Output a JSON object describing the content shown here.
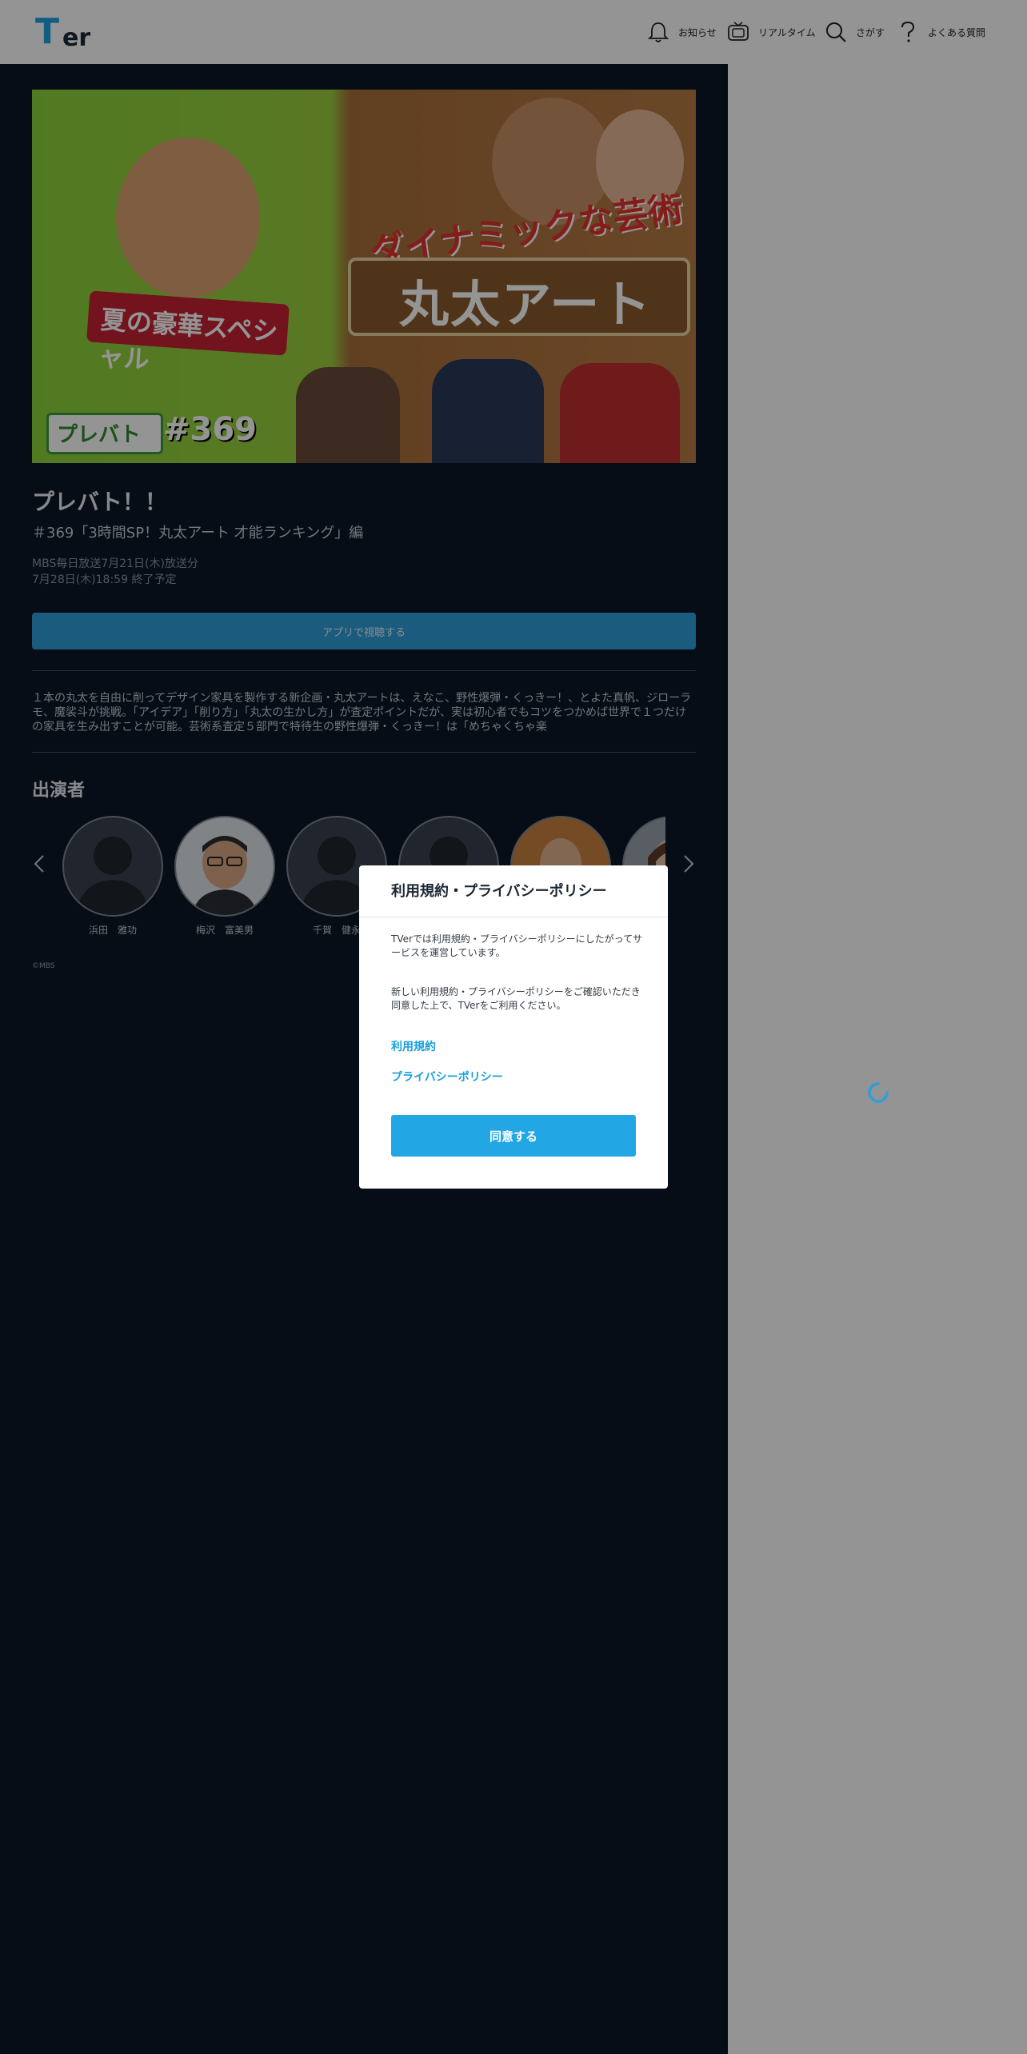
{
  "header": {
    "logo": "TVer",
    "nav": [
      {
        "label": "お知らせ",
        "icon": "bell-icon"
      },
      {
        "label": "リアルタイム",
        "icon": "tv-icon"
      },
      {
        "label": "さがす",
        "icon": "search-icon"
      },
      {
        "label": "よくある質問",
        "icon": "question-icon"
      }
    ]
  },
  "episode": {
    "thumbnail_badge": "プレバト",
    "thumbnail_number": "#369",
    "thumbnail_headline": "ダイナミックな芸術",
    "thumbnail_banner": "丸太アート",
    "thumbnail_ribbon": "夏の豪華スペシャル",
    "title": "プレバト！！",
    "subtitle": "＃369「3時間SP！丸太アート 才能ランキング」編",
    "broadcast": "MBS毎日放送7月21日(木)放送分",
    "expires": "7月28日(木)18:59 終了予定",
    "app_button": "アプリで視聴する",
    "description": "１本の丸太を自由に削ってデザイン家具を製作する新企画・丸太アートは、えなこ、野性爆弾・くっきー！、とよた真帆、ジローラモ、魔裟斗が挑戦。「アイデア」「削り方」「丸太の生かし方」が査定ポイントだが、実は初心者でもコツをつかめば世界で１つだけの家具を生み出すことが可能。芸術系査定５部門で特待生の野性爆弾・くっきー！は「めちゃくちゃ楽"
  },
  "cast": {
    "heading": "出演者",
    "members": [
      {
        "name": "浜田　雅功",
        "photo": "placeholder"
      },
      {
        "name": "梅沢　富美男",
        "photo": "photo"
      },
      {
        "name": "千賀　健永",
        "photo": "placeholder"
      },
      {
        "name": "",
        "photo": "placeholder"
      },
      {
        "name": "",
        "photo": "photo"
      },
      {
        "name": "",
        "photo": "photo"
      }
    ]
  },
  "copyright": "©MBS",
  "modal": {
    "title": "利用規約・プライバシーポリシー",
    "text1": "TVerでは利用規約・プライバシーポリシーにしたがってサービスを運営しています。",
    "text2": "新しい利用規約・プライバシーポリシーをご確認いただき同意した上で、TVerをご利用ください。",
    "link_terms": "利用規約",
    "link_privacy": "プライバシーポリシー",
    "agree_button": "同意する"
  },
  "colors": {
    "brand": "#1aa0dc",
    "main_bg": "#0b1728",
    "agree_button": "#22a7e4"
  }
}
